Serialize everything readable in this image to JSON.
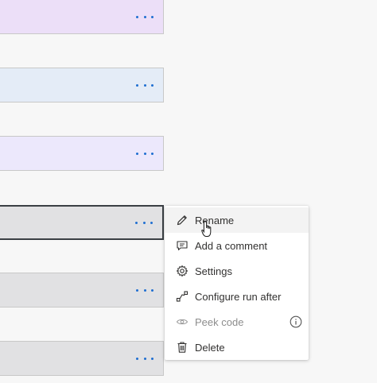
{
  "menu": {
    "items": [
      {
        "label": "Rename",
        "icon": "pencil-icon",
        "state": "hover"
      },
      {
        "label": "Add a comment",
        "icon": "comment-icon",
        "state": "normal"
      },
      {
        "label": "Settings",
        "icon": "gear-icon",
        "state": "normal"
      },
      {
        "label": "Configure run after",
        "icon": "run-after-icon",
        "state": "normal"
      },
      {
        "label": "Peek code",
        "icon": "eye-icon",
        "state": "disabled"
      },
      {
        "label": "Delete",
        "icon": "trash-icon",
        "state": "normal"
      }
    ]
  },
  "colors": {
    "accent": "#1f6fd1",
    "card_purple": "#ecdff8",
    "card_blue": "#e4ecf7",
    "card_lavender": "#ece8fc",
    "card_gray": "#e1e1e3",
    "selected_border": "#3a3f44"
  }
}
